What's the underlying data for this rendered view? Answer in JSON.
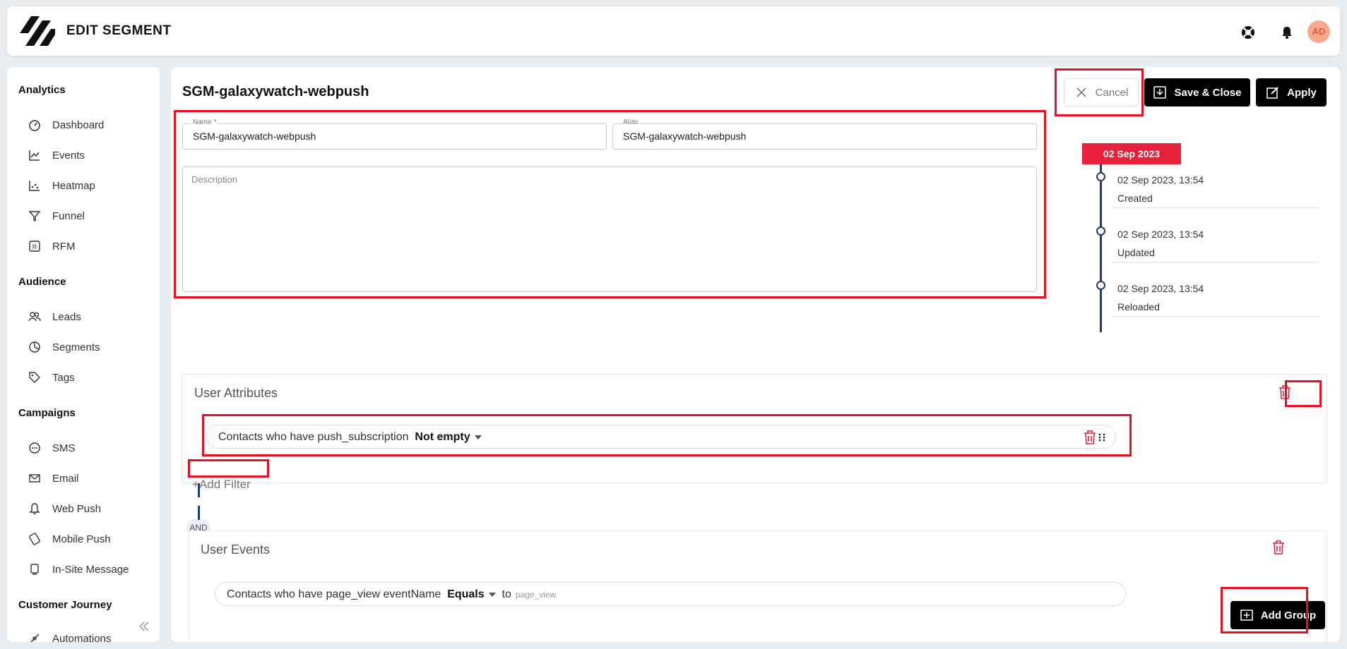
{
  "header": {
    "title": "EDIT SEGMENT",
    "avatar": "AD",
    "icons": [
      "help-lifebuoy-icon",
      "bell-icon"
    ]
  },
  "sidebar": {
    "sections": [
      {
        "title": "Analytics",
        "items": [
          {
            "label": "Dashboard",
            "icon": "dashboard-icon"
          },
          {
            "label": "Events",
            "icon": "line-chart-icon"
          },
          {
            "label": "Heatmap",
            "icon": "scatter-icon"
          },
          {
            "label": "Funnel",
            "icon": "funnel-icon"
          },
          {
            "label": "RFM",
            "icon": "rfm-box-icon"
          }
        ]
      },
      {
        "title": "Audience",
        "items": [
          {
            "label": "Leads",
            "icon": "users-icon"
          },
          {
            "label": "Segments",
            "icon": "pie-icon"
          },
          {
            "label": "Tags",
            "icon": "tag-icon"
          }
        ]
      },
      {
        "title": "Campaigns",
        "items": [
          {
            "label": "SMS",
            "icon": "chat-bubble-icon"
          },
          {
            "label": "Email",
            "icon": "envelope-icon"
          },
          {
            "label": "Web Push",
            "icon": "bell-outline-icon"
          },
          {
            "label": "Mobile Push",
            "icon": "mobile-push-icon"
          },
          {
            "label": "In-Site Message",
            "icon": "monitor-icon"
          }
        ]
      },
      {
        "title": "Customer Journey",
        "items": [
          {
            "label": "Automations",
            "icon": "automation-icon"
          }
        ]
      }
    ]
  },
  "main": {
    "segment_title": "SGM-galaxywatch-webpush",
    "actions": {
      "cancel": "Cancel",
      "save_close": "Save & Close",
      "apply": "Apply"
    },
    "form": {
      "name_label": "Name *",
      "name_value": "SGM-galaxywatch-webpush",
      "alias_label": "Alias",
      "alias_value": "SGM-galaxywatch-webpush",
      "description_placeholder": "Description"
    },
    "timeline": {
      "badge": "02 Sep 2023",
      "entries": [
        {
          "date": "02 Sep 2023, 13:54",
          "status": "Created"
        },
        {
          "date": "02 Sep 2023, 13:54",
          "status": "Updated"
        },
        {
          "date": "02 Sep 2023, 13:54",
          "status": "Reloaded"
        }
      ]
    },
    "groups": [
      {
        "title": "User Attributes",
        "filter": {
          "prefix": "Contacts who have push_subscription",
          "operator": "Not empty"
        },
        "add_filter": "Add Filter"
      },
      {
        "title": "User Events",
        "filter": {
          "prefix": "Contacts who have page_view eventName",
          "operator": "Equals",
          "to": "to",
          "value": "page_view"
        }
      }
    ],
    "connector": "AND",
    "add_group": "Add Group"
  },
  "colors": {
    "accent_red": "#e8203a",
    "timeline_blue": "#1f3b80",
    "highlight_box": "#e8101f"
  }
}
